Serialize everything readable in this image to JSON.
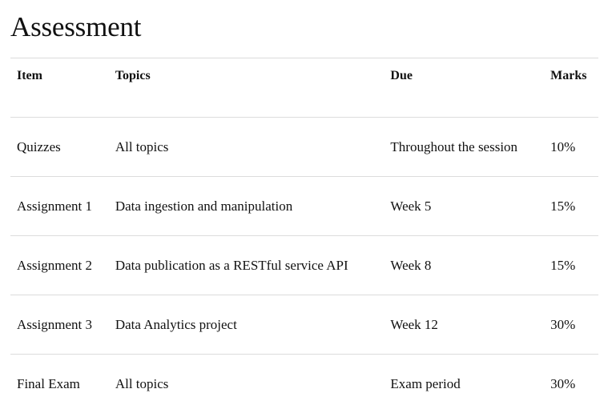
{
  "page": {
    "title": "Assessment"
  },
  "table": {
    "headers": {
      "item": "Item",
      "topics": "Topics",
      "due": "Due",
      "marks": "Marks"
    },
    "rows": [
      {
        "item": "Quizzes",
        "topics": "All topics",
        "due": "Throughout the session",
        "marks": "10%"
      },
      {
        "item": "Assignment 1",
        "topics": "Data ingestion and manipulation",
        "due": "Week 5",
        "marks": "15%"
      },
      {
        "item": "Assignment 2",
        "topics": "Data publication as a RESTful service API",
        "due": "Week 8",
        "marks": "15%"
      },
      {
        "item": "Assignment 3",
        "topics": "Data Analytics project",
        "due": "Week 12",
        "marks": "30%"
      },
      {
        "item": "Final Exam",
        "topics": "All topics",
        "due": "Exam period",
        "marks": "30%"
      }
    ]
  }
}
